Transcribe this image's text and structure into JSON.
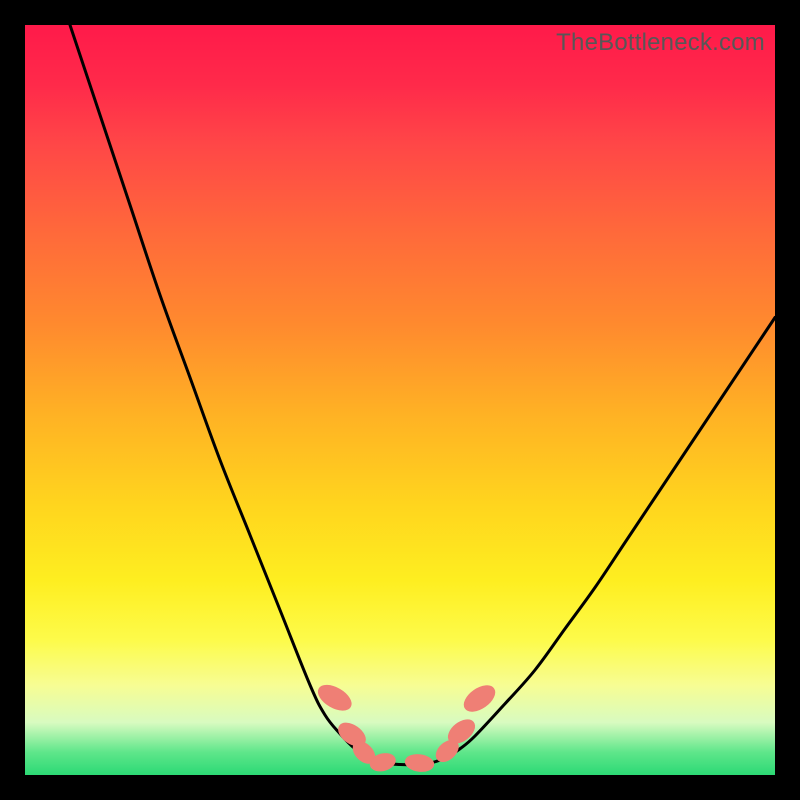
{
  "watermark": "TheBottleneck.com",
  "chart_data": {
    "type": "line",
    "title": "",
    "xlabel": "",
    "ylabel": "",
    "xlim": [
      0,
      100
    ],
    "ylim": [
      0,
      100
    ],
    "series": [
      {
        "name": "left-curve",
        "x": [
          6,
          10,
          14,
          18,
          22,
          26,
          30,
          34,
          38,
          40,
          42,
          44,
          46
        ],
        "values": [
          100,
          88,
          76,
          64,
          53,
          42,
          32,
          22,
          12,
          8,
          5.5,
          3.5,
          2.2
        ]
      },
      {
        "name": "right-curve",
        "x": [
          56,
          58,
          60,
          64,
          68,
          72,
          76,
          80,
          84,
          88,
          92,
          96,
          100
        ],
        "values": [
          2.2,
          3.5,
          5.2,
          9.5,
          14,
          19.5,
          25,
          31,
          37,
          43,
          49,
          55,
          61
        ]
      },
      {
        "name": "valley-floor",
        "x": [
          46,
          48,
          50,
          52,
          54,
          56
        ],
        "values": [
          2.2,
          1.6,
          1.4,
          1.4,
          1.6,
          2.2
        ]
      }
    ],
    "markers": [
      {
        "name": "left-upper-bead",
        "cx": 41.3,
        "cy": 10.3,
        "rx": 1.3,
        "ry": 2.4,
        "rot": -60
      },
      {
        "name": "left-mid-bead",
        "cx": 43.6,
        "cy": 5.4,
        "rx": 1.2,
        "ry": 2.0,
        "rot": -55
      },
      {
        "name": "left-lower-bead",
        "cx": 45.2,
        "cy": 3.0,
        "rx": 1.1,
        "ry": 1.7,
        "rot": -45
      },
      {
        "name": "floor-left-bead",
        "cx": 47.7,
        "cy": 1.7,
        "rx": 1.7,
        "ry": 1.1,
        "rot": -15
      },
      {
        "name": "floor-right-bead",
        "cx": 52.6,
        "cy": 1.6,
        "rx": 1.9,
        "ry": 1.1,
        "rot": 8
      },
      {
        "name": "right-lower-bead",
        "cx": 56.3,
        "cy": 3.2,
        "rx": 1.1,
        "ry": 1.7,
        "rot": 48
      },
      {
        "name": "right-mid-bead",
        "cx": 58.2,
        "cy": 5.8,
        "rx": 1.2,
        "ry": 2.0,
        "rot": 52
      },
      {
        "name": "right-upper-bead",
        "cx": 60.6,
        "cy": 10.2,
        "rx": 1.3,
        "ry": 2.3,
        "rot": 55
      }
    ],
    "colors": {
      "curve": "#000000",
      "bead_fill": "#ef7f75",
      "bead_stroke": "#ef7f75"
    }
  }
}
